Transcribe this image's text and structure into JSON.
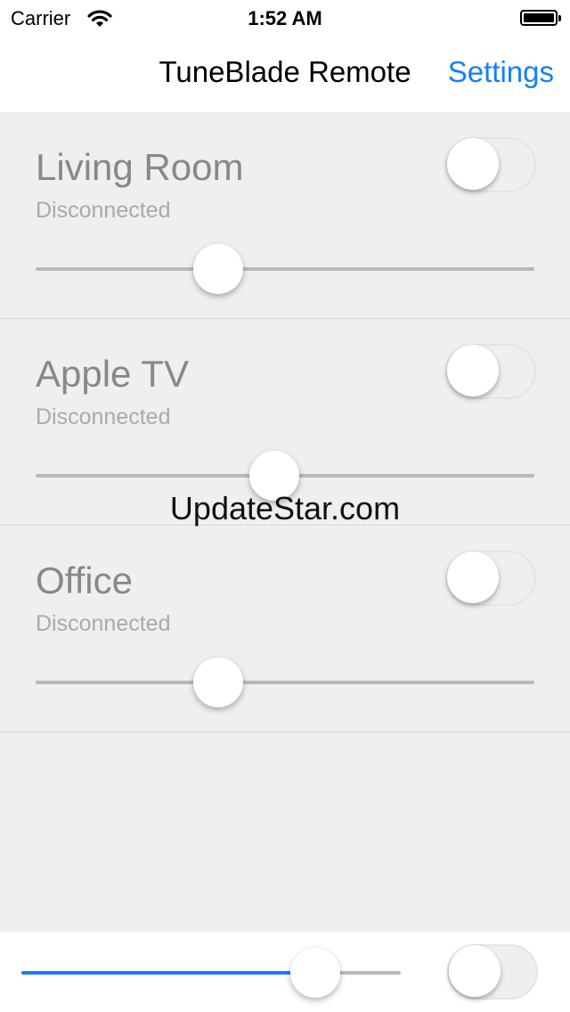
{
  "status_bar": {
    "carrier": "Carrier",
    "time": "1:52 AM",
    "wifi_icon": "wifi-icon",
    "battery_icon": "battery-icon"
  },
  "nav": {
    "title": "TuneBlade Remote",
    "settings_label": "Settings"
  },
  "rooms": [
    {
      "name": "Living Room",
      "status": "Disconnected",
      "enabled": false,
      "volume": 0.366
    },
    {
      "name": "Apple TV",
      "status": "Disconnected",
      "enabled": false,
      "volume": 0.479
    },
    {
      "name": "Office",
      "status": "Disconnected",
      "enabled": false,
      "volume": 0.366
    }
  ],
  "watermark": "UpdateStar.com",
  "master": {
    "volume": 0.775,
    "enabled": false
  },
  "colors": {
    "accent": "#157efb",
    "background": "#efefef",
    "text_secondary": "#888888"
  }
}
